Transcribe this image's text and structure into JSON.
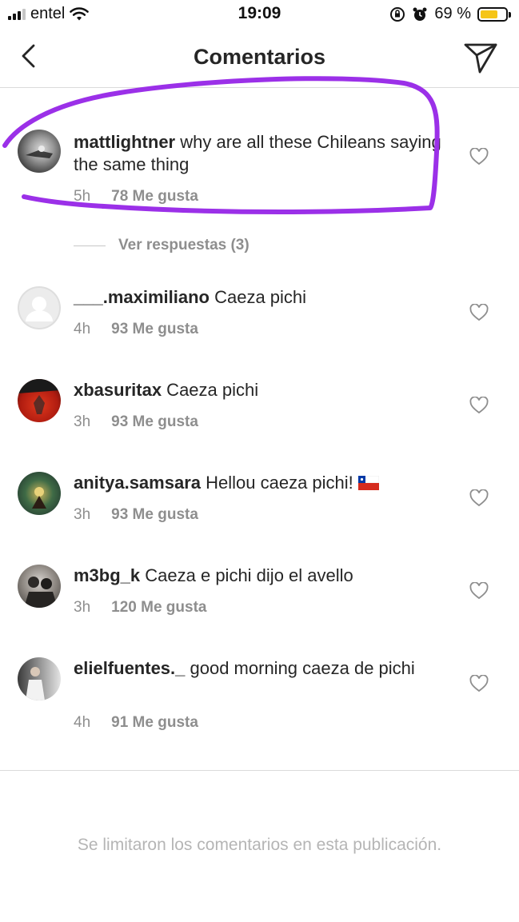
{
  "status_bar": {
    "carrier": "entel",
    "time": "19:09",
    "battery_text": "69 %",
    "battery_level": 0.69,
    "icons": [
      "signal-icon",
      "wifi-icon",
      "orientation-lock-icon",
      "alarm-icon",
      "battery-icon"
    ]
  },
  "header": {
    "title": "Comentarios",
    "back_icon": "chevron-left-icon",
    "send_icon": "paper-plane-icon"
  },
  "comments": [
    {
      "user": "mattlightner",
      "text": " why are all these Chileans saying the same thing",
      "time": "5h",
      "likes": "78 Me gusta"
    },
    {
      "user": "___.maximiliano",
      "text": " Caeza pichi",
      "time": "4h",
      "likes": "93 Me gusta"
    },
    {
      "user": "xbasuritax",
      "text": " Caeza pichi",
      "time": "3h",
      "likes": "93 Me gusta"
    },
    {
      "user": "anitya.samsara",
      "text": " Hellou caeza pichi! ",
      "time": "3h",
      "likes": "93 Me gusta"
    },
    {
      "user": "m3bg_k",
      "text": " Caeza e pichi dijo el avello",
      "time": "3h",
      "likes": "120 Me gusta"
    },
    {
      "user": "elielfuentes._",
      "text": " good morning caeza de pichi",
      "time": "4h",
      "likes": "91 Me gusta"
    }
  ],
  "replies_label": "Ver respuestas (3)",
  "footer_note": "Se limitaron los comentarios en esta publicación.",
  "colors": {
    "highlight": "#9b30e8",
    "meta": "#8e8e8e",
    "battery": "#f5c518"
  }
}
